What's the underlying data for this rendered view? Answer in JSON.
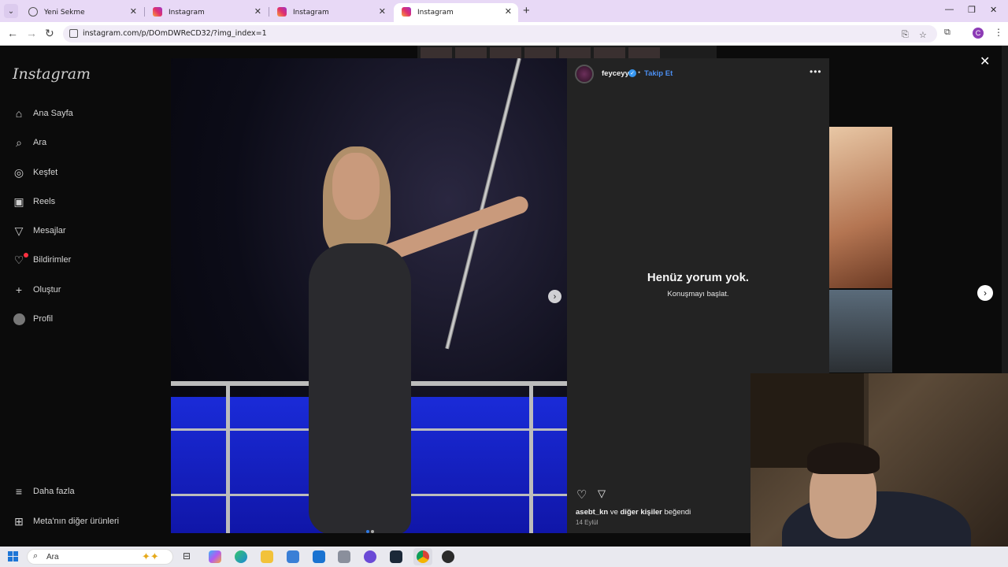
{
  "browser": {
    "tabs": [
      {
        "title": "Yeni Sekme",
        "icon": "globe-icon"
      },
      {
        "title": "Instagram",
        "icon": "instagram-icon"
      },
      {
        "title": "Instagram",
        "icon": "instagram-icon"
      },
      {
        "title": "Instagram",
        "icon": "instagram-icon",
        "active": true
      }
    ],
    "url": "instagram.com/p/DOmDWReCD32/?img_index=1",
    "profile_initial": "C"
  },
  "instagram": {
    "logo": "Instagram",
    "nav": [
      {
        "label": "Ana Sayfa",
        "icon": "home-icon"
      },
      {
        "label": "Ara",
        "icon": "search-icon"
      },
      {
        "label": "Keşfet",
        "icon": "compass-icon"
      },
      {
        "label": "Reels",
        "icon": "reels-icon"
      },
      {
        "label": "Mesajlar",
        "icon": "send-icon"
      },
      {
        "label": "Bildirimler",
        "icon": "heart-icon"
      },
      {
        "label": "Oluştur",
        "icon": "plus-icon"
      },
      {
        "label": "Profil",
        "icon": "avatar-icon"
      }
    ],
    "bottom_nav": [
      {
        "label": "Daha fazla",
        "icon": "menu-icon"
      },
      {
        "label": "Meta'nın diğer ürünleri",
        "icon": "grid-icon"
      }
    ]
  },
  "post": {
    "username": "feyceyy",
    "follow_label": "Takip Et",
    "bullet": "•",
    "empty_title": "Henüz yorum yok.",
    "empty_subtitle": "Konuşmayı başlat.",
    "likes_user": "asebt_kn",
    "likes_connector": " ve ",
    "likes_others": "diğer kişiler",
    "likes_suffix": " beğendi",
    "date": "14 Eylül",
    "image_index": 1,
    "image_count": 2
  },
  "taskbar": {
    "search_placeholder": "Ara"
  },
  "colors": {
    "follow_blue": "#4b8ef0",
    "verified_blue": "#3897f0",
    "notification_red": "#ff3040",
    "tabbar_bg": "#e8d9f6"
  }
}
